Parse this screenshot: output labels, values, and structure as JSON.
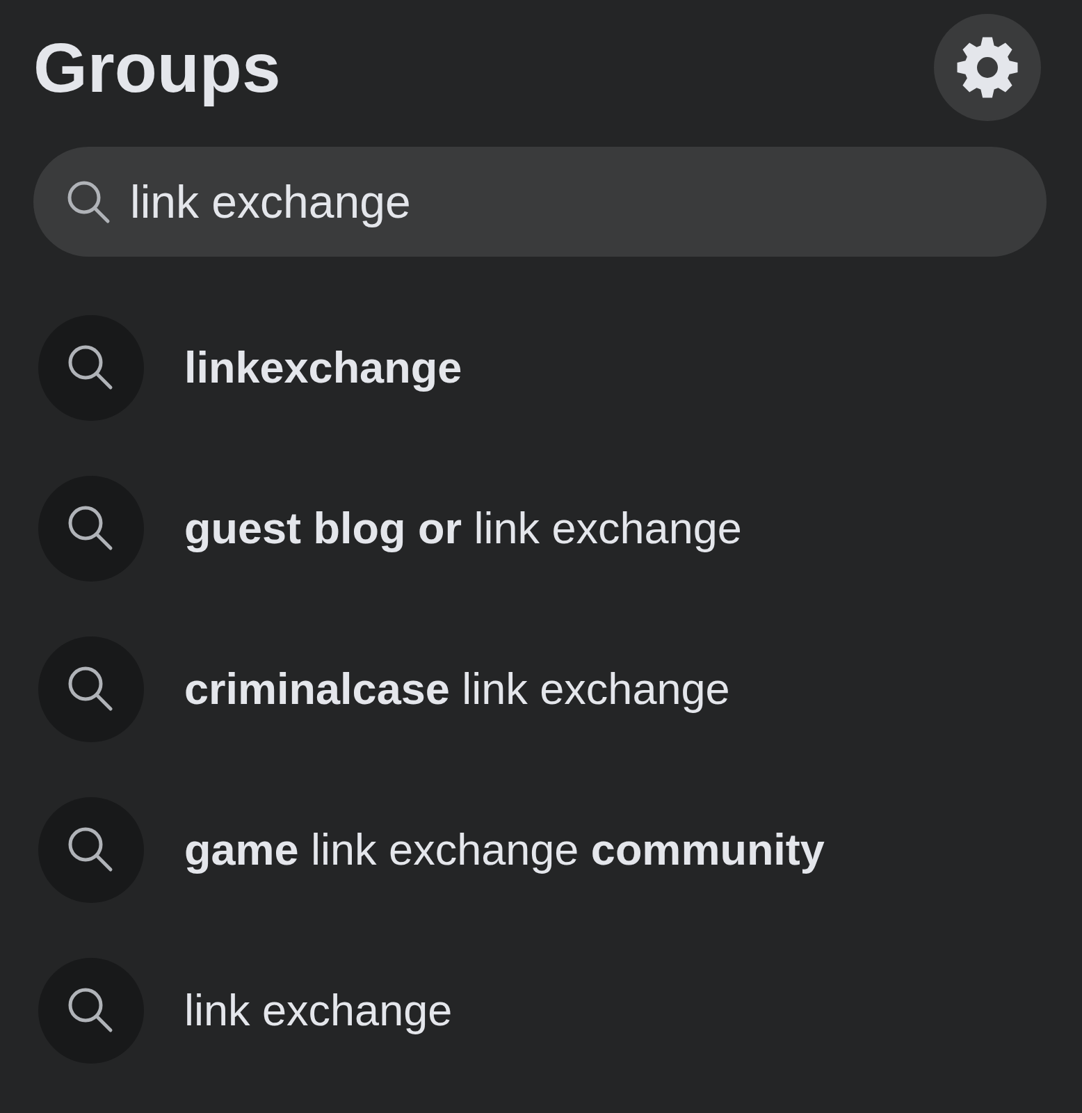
{
  "header": {
    "title": "Groups"
  },
  "search": {
    "value": "link exchange"
  },
  "suggestions": [
    {
      "parts": [
        {
          "text": "linkexchange",
          "bold": true
        }
      ]
    },
    {
      "parts": [
        {
          "text": "guest blog or",
          "bold": true
        },
        {
          "text": "link exchange",
          "bold": false
        }
      ]
    },
    {
      "parts": [
        {
          "text": "criminalcase",
          "bold": true
        },
        {
          "text": "link exchange",
          "bold": false
        }
      ]
    },
    {
      "parts": [
        {
          "text": "game",
          "bold": true
        },
        {
          "text": "link exchange",
          "bold": false
        },
        {
          "text": "community",
          "bold": true
        }
      ]
    },
    {
      "parts": [
        {
          "text": "link exchange",
          "bold": false
        }
      ]
    }
  ]
}
